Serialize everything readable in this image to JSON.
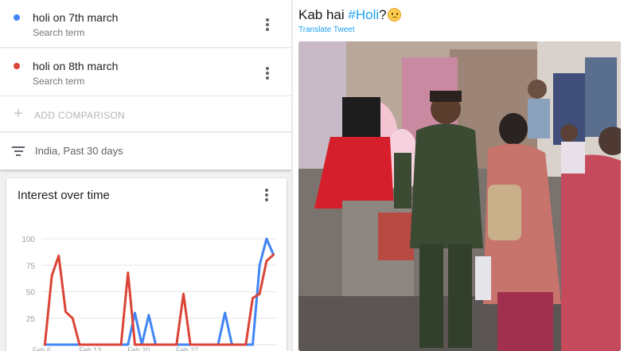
{
  "trends": {
    "terms": [
      {
        "name": "holi on 7th march",
        "sub": "Search term",
        "color": "#4285f4"
      },
      {
        "name": "holi on 8th march",
        "sub": "Search term",
        "color": "#db4437"
      }
    ],
    "add_comparison": "ADD COMPARISON",
    "filter": "India, Past 30 days",
    "card_title": "Interest over time",
    "icons": {
      "menu": "more-vert-icon",
      "add": "plus-icon",
      "filter": "filter-list-icon"
    }
  },
  "chart_data": {
    "type": "line",
    "title": "Interest over time",
    "x_ticks": [
      "Feb 6",
      "Feb 13",
      "Feb 20",
      "Feb 27"
    ],
    "y_ticks": [
      100,
      75,
      50,
      25
    ],
    "ylim": [
      0,
      100
    ],
    "grid": true,
    "series": [
      {
        "name": "holi on 7th march",
        "color": "#4285f4",
        "values": [
          0,
          0,
          0,
          0,
          0,
          0,
          0,
          0,
          0,
          0,
          0,
          0,
          0,
          30,
          0,
          28,
          0,
          0,
          0,
          0,
          0,
          0,
          0,
          0,
          0,
          0,
          30,
          0,
          0,
          0,
          0,
          75,
          100,
          85
        ]
      },
      {
        "name": "holi on 8th march",
        "color": "#db4437",
        "values": [
          0,
          65,
          84,
          31,
          25,
          0,
          0,
          0,
          0,
          0,
          0,
          0,
          68,
          0,
          0,
          0,
          0,
          0,
          0,
          0,
          48,
          0,
          0,
          0,
          0,
          0,
          0,
          0,
          0,
          0,
          44,
          48,
          79,
          85
        ]
      }
    ]
  },
  "tweet": {
    "text_prefix": "Kab hai ",
    "hashtag": "#Holi",
    "text_suffix": "?",
    "emoji": "confused-face-emoji",
    "translate": "Translate Tweet",
    "hashtag_color": "#1da1f2"
  }
}
